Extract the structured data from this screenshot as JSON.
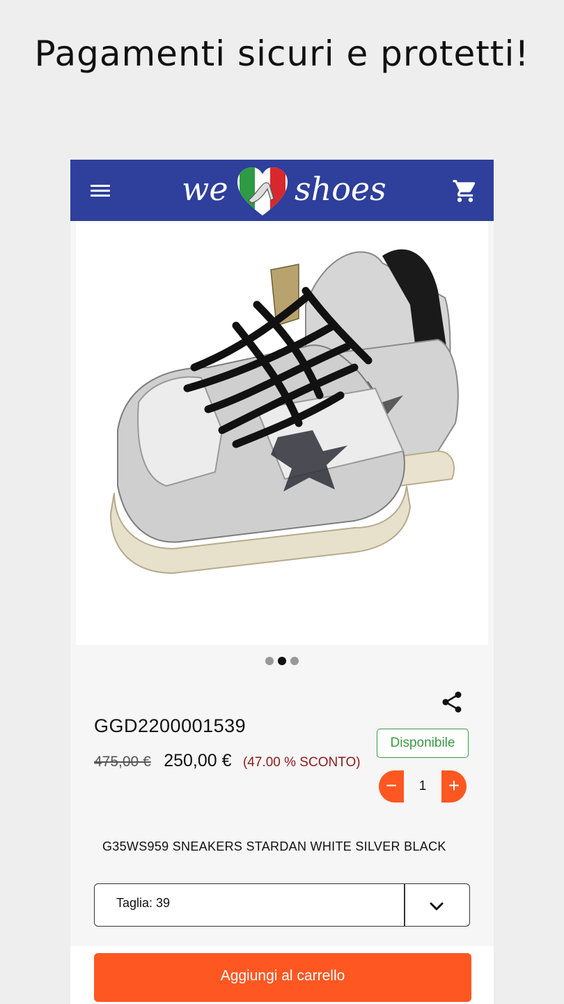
{
  "headline": "Pagamenti sicuri e protetti!",
  "appbar": {
    "logo_text_left": "we",
    "logo_text_right": "shoes",
    "menu_icon": "hamburger-menu-icon",
    "cart_icon": "shopping-cart-icon",
    "color": "#2e3f9c"
  },
  "gallery": {
    "image_count": 3,
    "active_index": 1
  },
  "product": {
    "sku": "GGD2200001539",
    "old_price": "475,00 €",
    "new_price": "250,00 €",
    "discount": "(47.00 % SCONTO)",
    "availability": "Disponibile",
    "quantity": "1",
    "description": "G35WS959 SNEAKERS STARDAN WHITE SILVER BLACK"
  },
  "size_select": {
    "label": "Taglia: 39"
  },
  "cta": {
    "label": "Aggiungi al carrello",
    "color": "#ff5722"
  },
  "qty_labels": {
    "minus": "−",
    "plus": "+"
  }
}
